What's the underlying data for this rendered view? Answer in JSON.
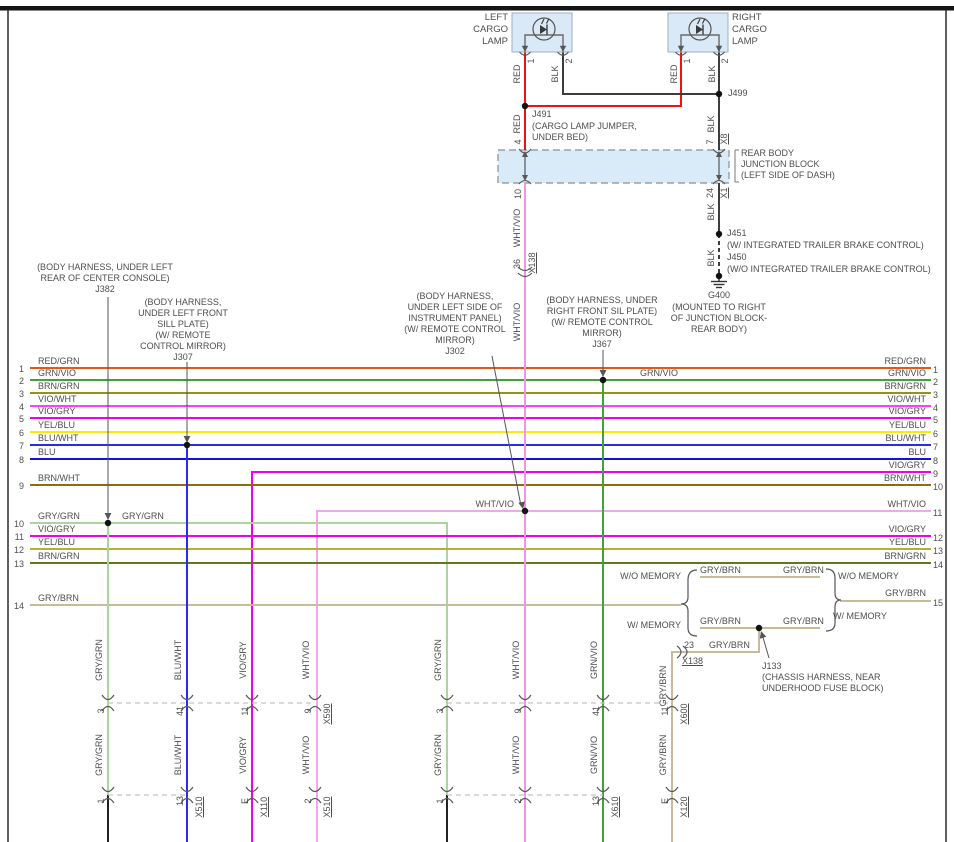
{
  "colors": {
    "red": "#ee1111",
    "blk": "#3d3d3d",
    "red_grn": "#e2571d",
    "grn_vio": "#3fa337",
    "brn_grn": "#97901f",
    "vio_wht": "#ff3cff",
    "vio_gry": "#ee00ee",
    "yel_blu": "#f0ec12",
    "blu_wht": "#2a2af0",
    "blu": "#1111d8",
    "brn_wht": "#8d6c0e",
    "gry_grn": "#abd49f",
    "yel_blu_dark": "#b9ae35",
    "brn_grn_dark": "#5c7a1e",
    "gry_brn": "#c7bb9b",
    "wht_vio": "#f193e6",
    "junction_fill": "#d9eaf8",
    "lamp_fill": "#d9e9f7"
  },
  "top": {
    "left_lamp": "LEFT\nCARGO\nLAMP",
    "right_lamp": "RIGHT\nCARGO\nLAMP",
    "pin1": "1",
    "pin2": "2",
    "red": "RED",
    "blk": "BLK",
    "j499": "J499",
    "j491": "J491",
    "j491_desc": "(CARGO LAMP JUMPER,\nUNDER BED)",
    "pin4": "4",
    "pin7": "7",
    "x8": "X8",
    "junction_block": "REAR BODY\nJUNCTION BLOCK\n(LEFT SIDE OF DASH)",
    "pin10": "10",
    "pin24": "24",
    "x1": "X1",
    "wht_vio": "WHT/VIO",
    "pin36": "36",
    "x138": "X138",
    "j451": "J451",
    "j451_desc": "(W/ INTEGRATED TRAILER BRAKE CONTROL)",
    "j450": "J450",
    "j450_desc": "(W/O INTEGRATED TRAILER BRAKE CONTROL)",
    "g400": "G400",
    "g400_desc": "(MOUNTED TO RIGHT\nOF JUNCTION BLOCK-\nREAR BODY)"
  },
  "annotations": {
    "j382": "(BODY HARNESS, UNDER LEFT\nREAR OF CENTER CONSOLE)\nJ382",
    "j307": "(BODY HARNESS,\nUNDER LEFT FRONT\nSILL PLATE)\n(W/ REMOTE\nCONTROL MIRROR)\nJ307",
    "j302": "(BODY HARNESS,\nUNDER LEFT SIDE OF\nINSTRUMENT PANEL)\n(W/ REMOTE CONTROL\nMIRROR)\nJ302",
    "j367": "(BODY HARNESS, UNDER\nRIGHT FRONT SIL PLATE)\n(W/ REMOTE CONTROL\nMIRROR)\nJ367",
    "j133": "J133\n(CHASSIS HARNESS, NEAR\nUNDERHOOD FUSE BLOCK)",
    "tap_gry_grn": "GRY/GRN",
    "tap_grn_vio": "GRN/VIO",
    "tap_wht_vio": "WHT/VIO"
  },
  "rows": {
    "left": [
      {
        "n": "1",
        "label": "RED/GRN"
      },
      {
        "n": "2",
        "label": "GRN/VIO"
      },
      {
        "n": "3",
        "label": "BRN/GRN"
      },
      {
        "n": "4",
        "label": "VIO/WHT"
      },
      {
        "n": "5",
        "label": "VIO/GRY"
      },
      {
        "n": "6",
        "label": "YEL/BLU"
      },
      {
        "n": "7",
        "label": "BLU/WHT"
      },
      {
        "n": "8",
        "label": "BLU"
      },
      {
        "n": "9",
        "label": "BRN/WHT"
      },
      {
        "n": "10",
        "label": "GRY/GRN"
      },
      {
        "n": "11",
        "label": "VIO/GRY"
      },
      {
        "n": "12",
        "label": "YEL/BLU"
      },
      {
        "n": "13",
        "label": "BRN/GRN"
      },
      {
        "n": "14",
        "label": "GRY/BRN"
      }
    ],
    "right": [
      {
        "n": "1",
        "label": "RED/GRN"
      },
      {
        "n": "2",
        "label": "GRN/VIO"
      },
      {
        "n": "3",
        "label": "BRN/GRN"
      },
      {
        "n": "4",
        "label": "VIO/WHT"
      },
      {
        "n": "5",
        "label": "VIO/GRY"
      },
      {
        "n": "6",
        "label": "YEL/BLU"
      },
      {
        "n": "7",
        "label": "BLU/WHT"
      },
      {
        "n": "8",
        "label": "BLU"
      },
      {
        "n": "9",
        "label": "VIO/GRY"
      },
      {
        "n": "10",
        "label": "BRN/WHT"
      },
      {
        "n": "11",
        "label": "WHT/VIO"
      },
      {
        "n": "12",
        "label": "VIO/GRY"
      },
      {
        "n": "13",
        "label": "YEL/BLU"
      },
      {
        "n": "14",
        "label": "BRN/GRN"
      },
      {
        "n": "15",
        "label": "GRY/BRN"
      }
    ]
  },
  "memory": {
    "wo": "W/O MEMORY",
    "w": "W/ MEMORY",
    "branch": "GRY/BRN",
    "pin23": "23",
    "x138": "X138"
  },
  "bottom": {
    "group1": [
      {
        "label": "GRY/GRN",
        "pin_a": "3",
        "pin_b": "1"
      },
      {
        "label": "BLU/WHT",
        "pin_a": "41",
        "pin_b": "13",
        "conn_b": "X510"
      },
      {
        "label": "VIO/GRY",
        "pin_a": "11",
        "pin_b": "E",
        "conn_b": "X110"
      },
      {
        "label": "WHT/VIO",
        "pin_a": "9",
        "conn_a": "X590",
        "pin_b": "2",
        "conn_b": "X510"
      }
    ],
    "group2": [
      {
        "label": "GRY/GRN",
        "pin_a": "3",
        "pin_b": "1"
      },
      {
        "label": "WHT/VIO",
        "pin_a": "9",
        "pin_b": "2"
      },
      {
        "label": "GRN/VIO",
        "pin_a": "41",
        "pin_b": "13",
        "conn_b": "X610"
      },
      {
        "label": "GRY/BRN",
        "pin_a": "11",
        "conn_a": "X600",
        "pin_b": "E",
        "conn_b": "X120"
      }
    ]
  }
}
